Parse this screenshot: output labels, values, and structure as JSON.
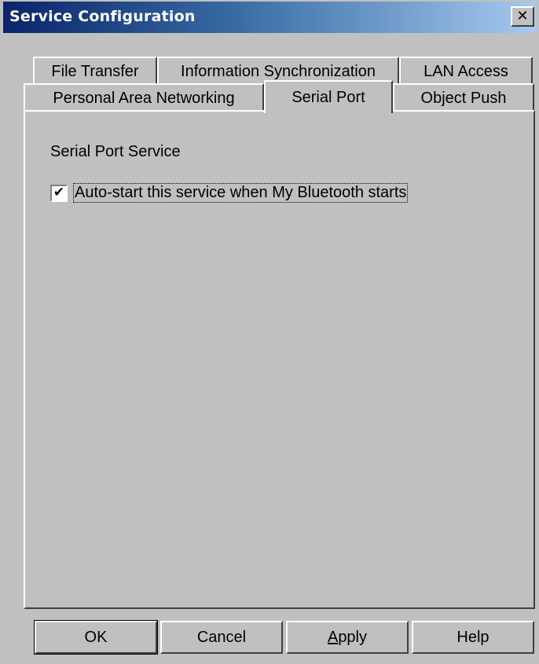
{
  "window": {
    "title": "Service Configuration",
    "close_glyph": "✕",
    "close_icon": "close-icon"
  },
  "tabs": {
    "row_back": [
      {
        "label": "File Transfer"
      },
      {
        "label": "Information Synchronization"
      },
      {
        "label": "LAN Access"
      }
    ],
    "row_front": [
      {
        "label": "Personal Area Networking"
      },
      {
        "label": "Serial Port",
        "selected": true
      },
      {
        "label": "Object Push"
      }
    ]
  },
  "panel": {
    "title": "Serial Port Service",
    "autostart": {
      "label": "Auto-start this service when My Bluetooth starts",
      "checked": true,
      "check_glyph": "✔",
      "icon": "checkmark-icon"
    }
  },
  "buttons": {
    "ok": "OK",
    "cancel": "Cancel",
    "apply_accel": "A",
    "apply_rest": "pply",
    "help": "Help"
  }
}
